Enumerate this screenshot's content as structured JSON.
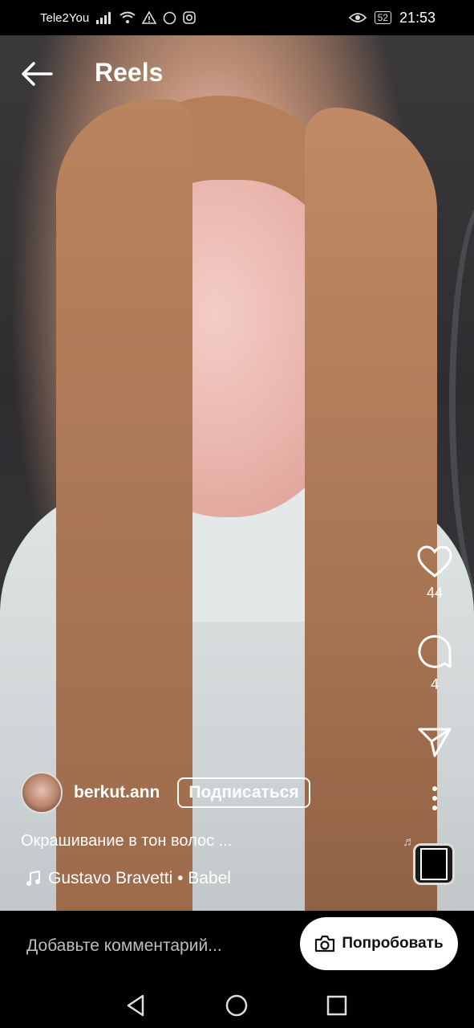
{
  "status_bar": {
    "carrier": "Tele2You",
    "battery": "52",
    "time": "21:53"
  },
  "header": {
    "title": "Reels"
  },
  "actions": {
    "likes": "44",
    "comments": "4"
  },
  "post": {
    "username": "berkut.ann",
    "follow_label": "Подписаться",
    "caption": "Окрашивание в тон волос ...",
    "music": "Gustavo Bravetti • Babel"
  },
  "bottom": {
    "comment_placeholder": "Добавьте комментарий...",
    "try_label": "Попробовать"
  },
  "icons": [
    "back-arrow-icon",
    "heart-icon",
    "comment-icon",
    "share-icon",
    "more-icon",
    "music-note-icon",
    "camera-icon",
    "nav-back-icon",
    "nav-home-icon",
    "nav-recents-icon"
  ]
}
